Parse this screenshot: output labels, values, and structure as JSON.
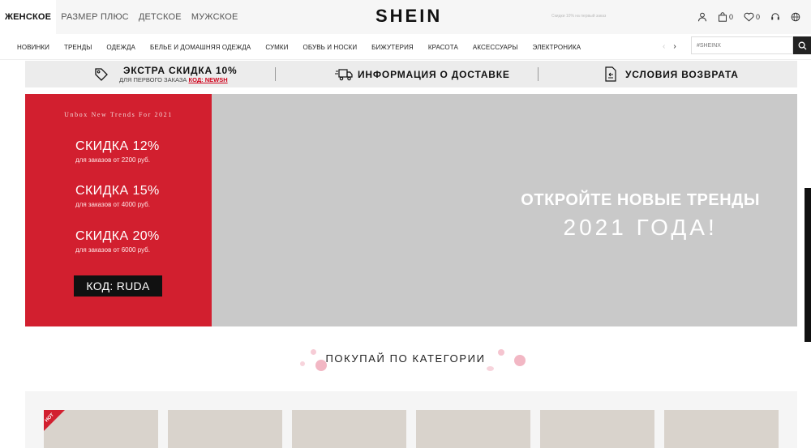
{
  "top_tabs": [
    "ЖЕНСКОЕ",
    "РАЗМЕР ПЛЮС",
    "ДЕТСКОЕ",
    "МУЖСКОЕ"
  ],
  "logo": "SHEIN",
  "header": {
    "search_hint": "Скидки 10% на первый заказ",
    "cart_count": "0",
    "wishlist_count": "0"
  },
  "nav": {
    "items": [
      "НОВИНКИ",
      "ТРЕНДЫ",
      "ОДЕЖДА",
      "БЕЛЬЕ И ДОМАШНЯЯ ОДЕЖДА",
      "СУМКИ",
      "ОБУВЬ И НОСКИ",
      "БИЖУТЕРИЯ",
      "КРАСОТА",
      "АКСЕССУАРЫ",
      "ЭЛЕКТРОНИКА"
    ],
    "prev_arrow": "‹",
    "next_arrow": "›",
    "search_placeholder": "#SHEINX"
  },
  "info_strip": {
    "discount_title": "ЭКСТРА СКИДКА 10%",
    "discount_sub": "ДЛЯ ПЕРВОГО ЗАКАЗА",
    "discount_code": "КОД: NEWSH",
    "delivery": "ИНФОРМАЦИЯ О ДОСТАВКЕ",
    "returns": "УСЛОВИЯ ВОЗВРАТА"
  },
  "hero": {
    "tagline": "Unbox New Trends For 2021",
    "offers": [
      {
        "title": "СКИДКА 12%",
        "sub": "для заказов от 2200 руб."
      },
      {
        "title": "СКИДКА 15%",
        "sub": "для заказов от 4000 руб."
      },
      {
        "title": "СКИДКА 20%",
        "sub": "для заказов от 6000 руб."
      }
    ],
    "promo_code": "КОД: RUDA",
    "headline_1": "ОТКРОЙТЕ НОВЫЕ ТРЕНДЫ",
    "headline_2": "2021 ГОДА!"
  },
  "section": {
    "title": "ПОКУПАЙ ПО КАТЕГОРИИ",
    "hot_badge": "HOT"
  },
  "colors": {
    "accent_red": "#d21f2f",
    "code_red": "#d0021b",
    "dark": "#111111"
  }
}
